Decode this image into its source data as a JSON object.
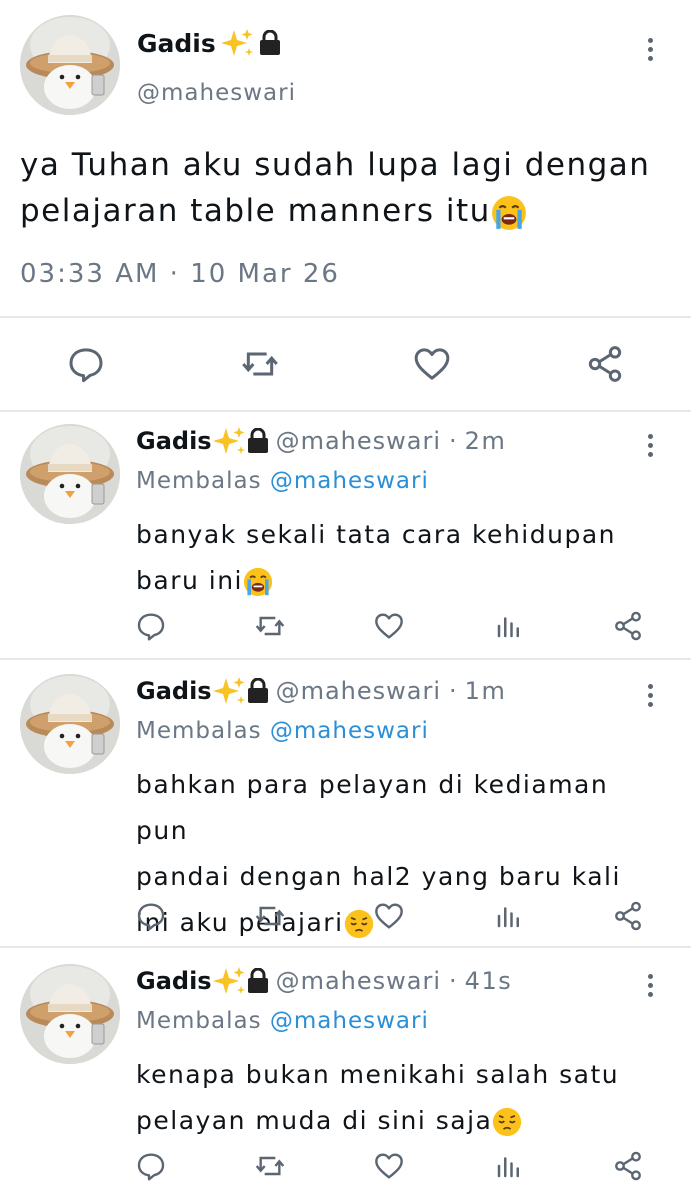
{
  "main_tweet": {
    "display_name": "Gadis",
    "handle": "@maheswari",
    "text_line1": "ya Tuhan aku sudah lupa lagi dengan",
    "text_line2": "pelajaran table manners itu",
    "timestamp": "03:33 AM · 10 Mar 26",
    "actions": [
      "reply-icon",
      "retweet-icon",
      "like-icon",
      "share-icon"
    ]
  },
  "replies": [
    {
      "display_name": "Gadis",
      "handle": "@maheswari",
      "time": "2m",
      "replying_prefix": "Membalas",
      "replying_to": "@maheswari",
      "lines": [
        "banyak sekali tata cara kehidupan",
        "baru ini"
      ],
      "emoji": "crying-face"
    },
    {
      "display_name": "Gadis",
      "handle": "@maheswari",
      "time": "1m",
      "replying_prefix": "Membalas",
      "replying_to": "@maheswari",
      "lines": [
        "bahkan para pelayan di kediaman pun",
        "pandai dengan hal2 yang baru kali",
        "ini aku pelajari"
      ],
      "emoji": "pensive-face"
    },
    {
      "display_name": "Gadis",
      "handle": "@maheswari",
      "time": "41s",
      "replying_prefix": "Membalas",
      "replying_to": "@maheswari",
      "lines": [
        "kenapa bukan menikahi salah satu",
        "pelayan muda di sini saja"
      ],
      "emoji": "pensive-face"
    }
  ],
  "colors": {
    "text": "#0f1419",
    "muted": "#6b7785",
    "link": "#2b8fd6",
    "divider": "#e6e9ec"
  }
}
